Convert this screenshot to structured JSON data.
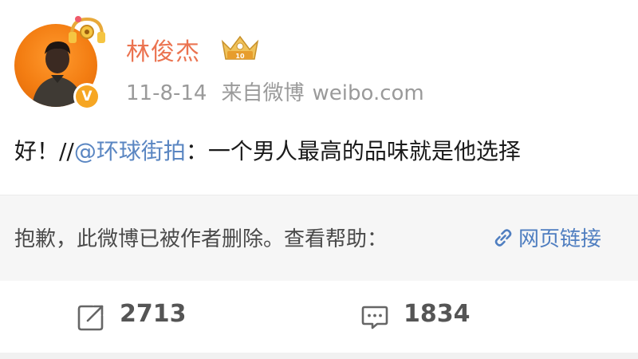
{
  "author": {
    "name": "林俊杰",
    "verified_badge": "V",
    "avatar_icon": "user-avatar",
    "vip_icon": "vip-crown-icon",
    "pendant_icon": "headphones-pendant-icon"
  },
  "post": {
    "date": "11-8-14",
    "source_label": "来自微博",
    "source_site": "weibo.com",
    "text_prefix": "好！//",
    "mention": "@环球街拍",
    "text_rest": "：一个男人最高的品味就是他选择"
  },
  "repost": {
    "deleted_notice": "抱歉，此微博已被作者删除。查看帮助：",
    "help_link": "网页链接",
    "link_icon": "link-icon"
  },
  "actions": {
    "repost_count": "2713",
    "comment_count": "1834",
    "repost_icon": "repost-icon",
    "comment_icon": "comment-icon"
  },
  "colors": {
    "username": "#eb7350",
    "link": "#4f7ec0",
    "meta": "#9a9a9a",
    "verified": "#f6a623"
  }
}
